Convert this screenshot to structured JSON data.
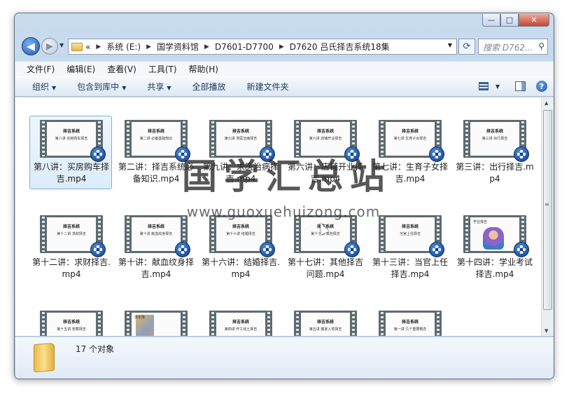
{
  "window": {
    "caption_buttons": {
      "minimize": "—",
      "maximize": "□",
      "close": "✕"
    }
  },
  "nav": {
    "back_icon": "arrow-left-icon",
    "forward_icon": "arrow-right-icon",
    "breadcrumb_overflow": "«",
    "breadcrumbs": [
      "系统 (E:)",
      "国学资料馆",
      "D7601-D7700",
      "D7620 吕氏择吉系统18集"
    ],
    "search_placeholder": "搜索 D762...",
    "refresh_icon": "refresh-icon"
  },
  "menu": [
    "文件(F)",
    "编辑(E)",
    "查看(V)",
    "工具(T)",
    "帮助(H)"
  ],
  "toolbar": {
    "buttons": [
      {
        "label": "组织",
        "dropdown": true
      },
      {
        "label": "包含到库中",
        "dropdown": true
      },
      {
        "label": "共享",
        "dropdown": true
      },
      {
        "label": "全部播放",
        "dropdown": false
      },
      {
        "label": "新建文件夹",
        "dropdown": false
      }
    ],
    "help_label": "?"
  },
  "files": [
    {
      "name": "第八讲：买房购车择吉.mp4",
      "selected": true,
      "thumb": {
        "title": "择吉系统",
        "subtitle": "第八讲 买房购车择吉",
        "style": "text"
      }
    },
    {
      "name": "第二讲：择吉系统必备知识.mp4",
      "selected": false,
      "thumb": {
        "title": "择吉系统",
        "subtitle": "第二讲 必备基础知识",
        "style": "text"
      }
    },
    {
      "name": "第九讲：求医治病择吉.mp4",
      "selected": false,
      "thumb": {
        "title": "择吉系统",
        "subtitle": "第九讲 求医治病择吉",
        "style": "text"
      }
    },
    {
      "name": "第六讲：店铺开业择吉.mp4",
      "selected": false,
      "thumb": {
        "title": "择吉系统",
        "subtitle": "第六讲 店铺开业择吉",
        "style": "text"
      }
    },
    {
      "name": "第七讲：生育子女择吉.mp4",
      "selected": false,
      "thumb": {
        "title": "择吉系统",
        "subtitle": "第七讲 生育子女择吉",
        "style": "text"
      }
    },
    {
      "name": "第三讲：出行择吉.mp4",
      "selected": false,
      "thumb": {
        "title": "择吉系统",
        "subtitle": "第三讲 出行择吉",
        "style": "text"
      }
    },
    {
      "name": "第十二讲：求财择吉.mp4",
      "selected": false,
      "thumb": {
        "title": "择吉系统",
        "subtitle": "第十二讲 求财择吉",
        "style": "text"
      }
    },
    {
      "name": "第十讲：献血纹身择吉.mp4",
      "selected": false,
      "thumb": {
        "title": "择吉系统",
        "subtitle": "第十讲 献血纹身择吉",
        "style": "text"
      }
    },
    {
      "name": "第十六讲：结婚择吉.mp4",
      "selected": false,
      "thumb": {
        "title": "择吉系统",
        "subtitle": "第十六讲 结婚择吉",
        "style": "text"
      }
    },
    {
      "name": "第十七讲：其他择吉问题.mp4",
      "selected": false,
      "thumb": {
        "title": "择吉系统",
        "subtitle": "第十七讲 其他择吉",
        "style": "text"
      }
    },
    {
      "name": "第十三讲：当官上任择吉.mp4",
      "selected": false,
      "thumb": {
        "title": "择吉系统",
        "subtitle": "当官上任择吉",
        "style": "text"
      }
    },
    {
      "name": "第十四讲：学业考试择吉.mp4",
      "selected": false,
      "thumb": {
        "title": "学业择吉",
        "subtitle": "",
        "style": "cartoon"
      }
    },
    {
      "name": "",
      "selected": false,
      "thumb": {
        "title": "择吉系统",
        "subtitle": "第十五讲 安葬择吉",
        "style": "text"
      }
    },
    {
      "name": "",
      "selected": false,
      "thumb": {
        "title": "流年择",
        "subtitle": "",
        "style": "painting"
      }
    },
    {
      "name": "",
      "selected": false,
      "thumb": {
        "title": "择吉系统",
        "subtitle": "第四讲 开工动土择吉",
        "style": "text"
      }
    },
    {
      "name": "",
      "selected": false,
      "thumb": {
        "title": "择吉系统",
        "subtitle": "第五讲 搬家入宅择吉",
        "style": "text"
      }
    },
    {
      "name": "",
      "selected": false,
      "thumb": {
        "title": "择吉系统",
        "subtitle": "第一讲 几个重要概念",
        "style": "text"
      }
    }
  ],
  "watermark": {
    "title": "国学汇总站",
    "url": "www.guoxuehuizong.com"
  },
  "status": {
    "count_label": "17 个对象"
  }
}
